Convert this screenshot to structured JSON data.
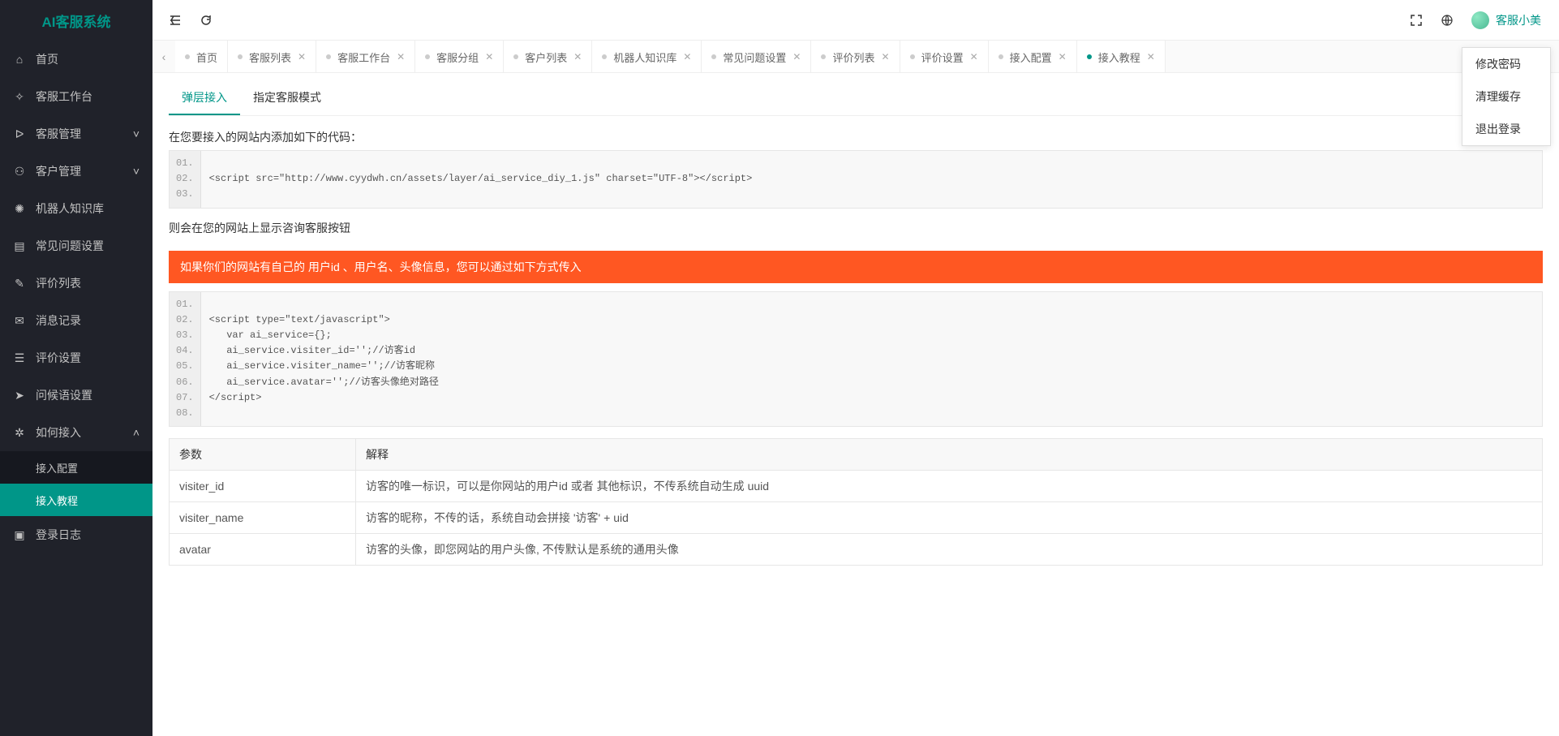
{
  "app": {
    "title": "AI客服系统"
  },
  "sidebar": {
    "items": [
      {
        "label": "首页",
        "icon": "home"
      },
      {
        "label": "客服工作台",
        "icon": "workbench"
      },
      {
        "label": "客服管理",
        "icon": "user",
        "expandable": true
      },
      {
        "label": "客户管理",
        "icon": "group",
        "expandable": true
      },
      {
        "label": "机器人知识库",
        "icon": "robot"
      },
      {
        "label": "常见问题设置",
        "icon": "faq"
      },
      {
        "label": "评价列表",
        "icon": "thumb"
      },
      {
        "label": "消息记录",
        "icon": "chat"
      },
      {
        "label": "评价设置",
        "icon": "rate"
      },
      {
        "label": "问候语设置",
        "icon": "send"
      },
      {
        "label": "如何接入",
        "icon": "gear",
        "expandable": true,
        "open": true,
        "children": [
          {
            "label": "接入配置"
          },
          {
            "label": "接入教程",
            "active": true
          }
        ]
      },
      {
        "label": "登录日志",
        "icon": "log"
      }
    ]
  },
  "header": {
    "username": "客服小美",
    "dropdown": [
      {
        "label": "修改密码"
      },
      {
        "label": "清理缓存"
      },
      {
        "label": "退出登录"
      }
    ]
  },
  "tabs": [
    {
      "label": "首页"
    },
    {
      "label": "客服列表"
    },
    {
      "label": "客服工作台"
    },
    {
      "label": "客服分组"
    },
    {
      "label": "客户列表"
    },
    {
      "label": "机器人知识库"
    },
    {
      "label": "常见问题设置"
    },
    {
      "label": "评价列表"
    },
    {
      "label": "评价设置"
    },
    {
      "label": "接入配置"
    },
    {
      "label": "接入教程",
      "active": true
    }
  ],
  "inner_tabs": [
    {
      "label": "弹层接入",
      "active": true
    },
    {
      "label": "指定客服模式"
    }
  ],
  "sections": {
    "title1": "在您要接入的网站内添加如下的代码：",
    "code1": {
      "nums": "01.\n02.\n03.",
      "code": "\n<script src=\"http://www.cyydwh.cn/assets/layer/ai_service_diy_1.js\" charset=\"UTF-8\"></script>\n"
    },
    "title2": "则会在您的网站上显示咨询客服按钮",
    "alert": "如果你们的网站有自己的 用户id 、用户名、头像信息，您可以通过如下方式传入",
    "code2": {
      "nums": "01.\n02.\n03.\n04.\n05.\n06.\n07.\n08.",
      "code": "\n<script type=\"text/javascript\">\n   var ai_service={};\n   ai_service.visiter_id='';//访客id\n   ai_service.visiter_name='';//访客昵称\n   ai_service.avatar='';//访客头像绝对路径\n</script>\n"
    }
  },
  "table": {
    "headers": [
      "参数",
      "解释"
    ],
    "rows": [
      [
        "visiter_id",
        "访客的唯一标识，可以是你网站的用户id 或者 其他标识，不传系统自动生成 uuid"
      ],
      [
        "visiter_name",
        "访客的昵称，不传的话，系统自动会拼接 '访客' + uid"
      ],
      [
        "avatar",
        "访客的头像，即您网站的用户头像, 不传默认是系统的通用头像"
      ]
    ]
  }
}
